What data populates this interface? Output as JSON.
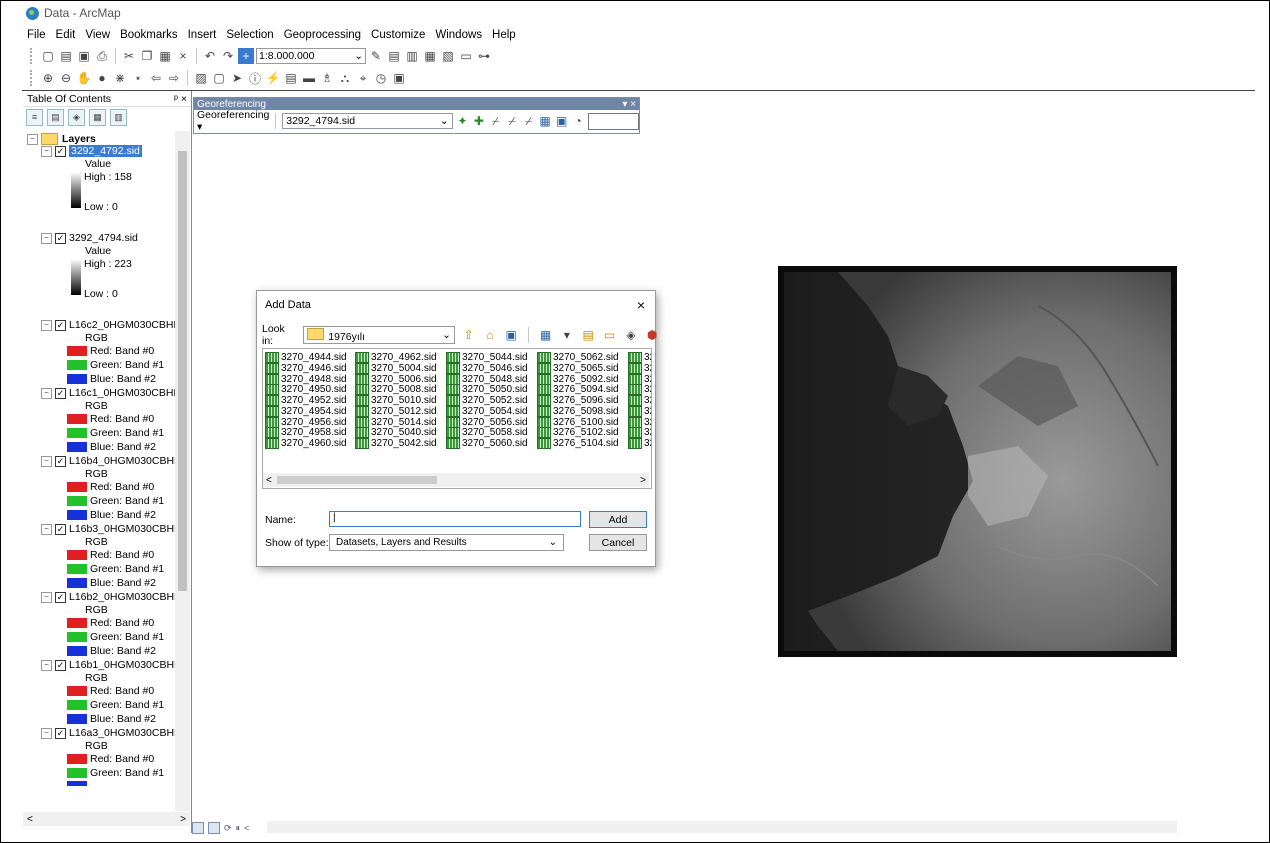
{
  "window": {
    "title": "Data - ArcMap"
  },
  "menu": [
    "File",
    "Edit",
    "View",
    "Bookmarks",
    "Insert",
    "Selection",
    "Geoprocessing",
    "Customize",
    "Windows",
    "Help"
  ],
  "toolbar": {
    "scale": "1:8.000.000"
  },
  "toc": {
    "title": "Table Of Contents",
    "pin": "\u0002 ×",
    "layers_label": "Layers",
    "items": [
      {
        "name": "3292_4792.sid",
        "value_label": "Value",
        "high": "High : 158",
        "low": "Low : 0"
      },
      {
        "name": "3292_4794.sid",
        "value_label": "Value",
        "high": "High : 223",
        "low": "Low : 0"
      },
      {
        "name": "L16c2_0HGM030CBHF",
        "rgb": "RGB",
        "bands": [
          "Red:  Band #0",
          "Green: Band #1",
          "Blue:  Band #2"
        ]
      },
      {
        "name": "L16c1_0HGM030CBHF",
        "rgb": "RGB",
        "bands": [
          "Red:  Band #0",
          "Green: Band #1",
          "Blue:  Band #2"
        ]
      },
      {
        "name": "L16b4_0HGM030CBHF",
        "rgb": "RGB",
        "bands": [
          "Red:  Band #0",
          "Green: Band #1",
          "Blue:  Band #2"
        ]
      },
      {
        "name": "L16b3_0HGM030CBHF",
        "rgb": "RGB",
        "bands": [
          "Red:  Band #0",
          "Green: Band #1",
          "Blue:  Band #2"
        ]
      },
      {
        "name": "L16b2_0HGM030CBHF",
        "rgb": "RGB",
        "bands": [
          "Red:  Band #0",
          "Green: Band #1",
          "Blue:  Band #2"
        ]
      },
      {
        "name": "L16b1_0HGM030CBHF",
        "rgb": "RGB",
        "bands": [
          "Red:  Band #0",
          "Green: Band #1",
          "Blue:  Band #2"
        ]
      },
      {
        "name": "L16a3_0HGM030CBHF",
        "rgb": "RGB",
        "bands": [
          "Red:  Band #0",
          "Green: Band #1"
        ]
      }
    ],
    "colors": {
      "red": "#e02020",
      "green": "#22c02a",
      "blue": "#1830d8",
      "selected": "#3a7ad0"
    }
  },
  "georef": {
    "title": "Georeferencing",
    "menu_label": "Georeferencing ▾",
    "layer": "3292_4794.sid"
  },
  "dialog": {
    "title": "Add Data",
    "look_in_label": "Look in:",
    "folder": "1976yılı",
    "files": [
      [
        "3270_4944.sid",
        "3270_4946.sid",
        "3270_4948.sid",
        "3270_4950.sid",
        "3270_4952.sid",
        "3270_4954.sid",
        "3270_4956.sid",
        "3270_4958.sid",
        "3270_4960.sid"
      ],
      [
        "3270_4962.sid",
        "3270_5004.sid",
        "3270_5006.sid",
        "3270_5008.sid",
        "3270_5010.sid",
        "3270_5012.sid",
        "3270_5014.sid",
        "3270_5040.sid",
        "3270_5042.sid"
      ],
      [
        "3270_5044.sid",
        "3270_5046.sid",
        "3270_5048.sid",
        "3270_5050.sid",
        "3270_5052.sid",
        "3270_5054.sid",
        "3270_5056.sid",
        "3270_5058.sid",
        "3270_5060.sid"
      ],
      [
        "3270_5062.sid",
        "3270_5065.sid",
        "3276_5092.sid",
        "3276_5094.sid",
        "3276_5096.sid",
        "3276_5098.sid",
        "3276_5100.sid",
        "3276_5102.sid",
        "3276_5104.sid"
      ],
      [
        "32",
        "32",
        "32",
        "32",
        "32",
        "32",
        "32",
        "32",
        "32"
      ]
    ],
    "name_label": "Name:",
    "name_value": "|",
    "type_label": "Show of type:",
    "type_value": "Datasets, Layers and Results",
    "add_button": "Add",
    "cancel_button": "Cancel"
  }
}
